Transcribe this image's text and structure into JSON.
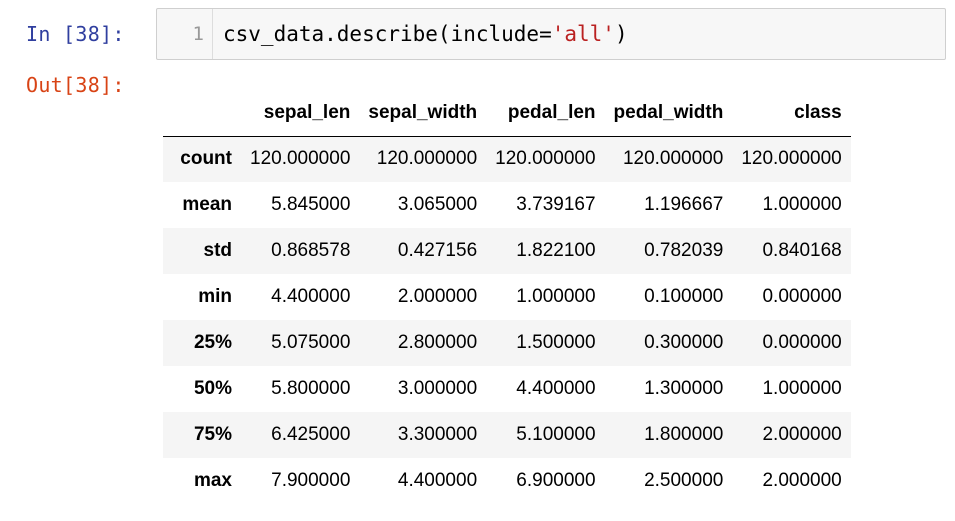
{
  "input_prompt": "In [38]:",
  "output_prompt": "Out[38]:",
  "code": {
    "line_number": "1",
    "before": "csv_data.describe(include=",
    "string": "'all'",
    "after": ")"
  },
  "table": {
    "columns": [
      "sepal_len",
      "sepal_width",
      "pedal_len",
      "pedal_width",
      "class"
    ],
    "rows": [
      {
        "label": "count",
        "values": [
          "120.000000",
          "120.000000",
          "120.000000",
          "120.000000",
          "120.000000"
        ]
      },
      {
        "label": "mean",
        "values": [
          "5.845000",
          "3.065000",
          "3.739167",
          "1.196667",
          "1.000000"
        ]
      },
      {
        "label": "std",
        "values": [
          "0.868578",
          "0.427156",
          "1.822100",
          "0.782039",
          "0.840168"
        ]
      },
      {
        "label": "min",
        "values": [
          "4.400000",
          "2.000000",
          "1.000000",
          "0.100000",
          "0.000000"
        ]
      },
      {
        "label": "25%",
        "values": [
          "5.075000",
          "2.800000",
          "1.500000",
          "0.300000",
          "0.000000"
        ]
      },
      {
        "label": "50%",
        "values": [
          "5.800000",
          "3.000000",
          "4.400000",
          "1.300000",
          "1.000000"
        ]
      },
      {
        "label": "75%",
        "values": [
          "6.425000",
          "3.300000",
          "5.100000",
          "1.800000",
          "2.000000"
        ]
      },
      {
        "label": "max",
        "values": [
          "7.900000",
          "4.400000",
          "6.900000",
          "2.500000",
          "2.000000"
        ]
      }
    ]
  },
  "colors": {
    "input_prompt": "#303f9f",
    "output_prompt": "#d84315",
    "code_string": "#ba2121",
    "input_background": "#f7f7f7",
    "row_stripe": "#f5f5f5"
  }
}
